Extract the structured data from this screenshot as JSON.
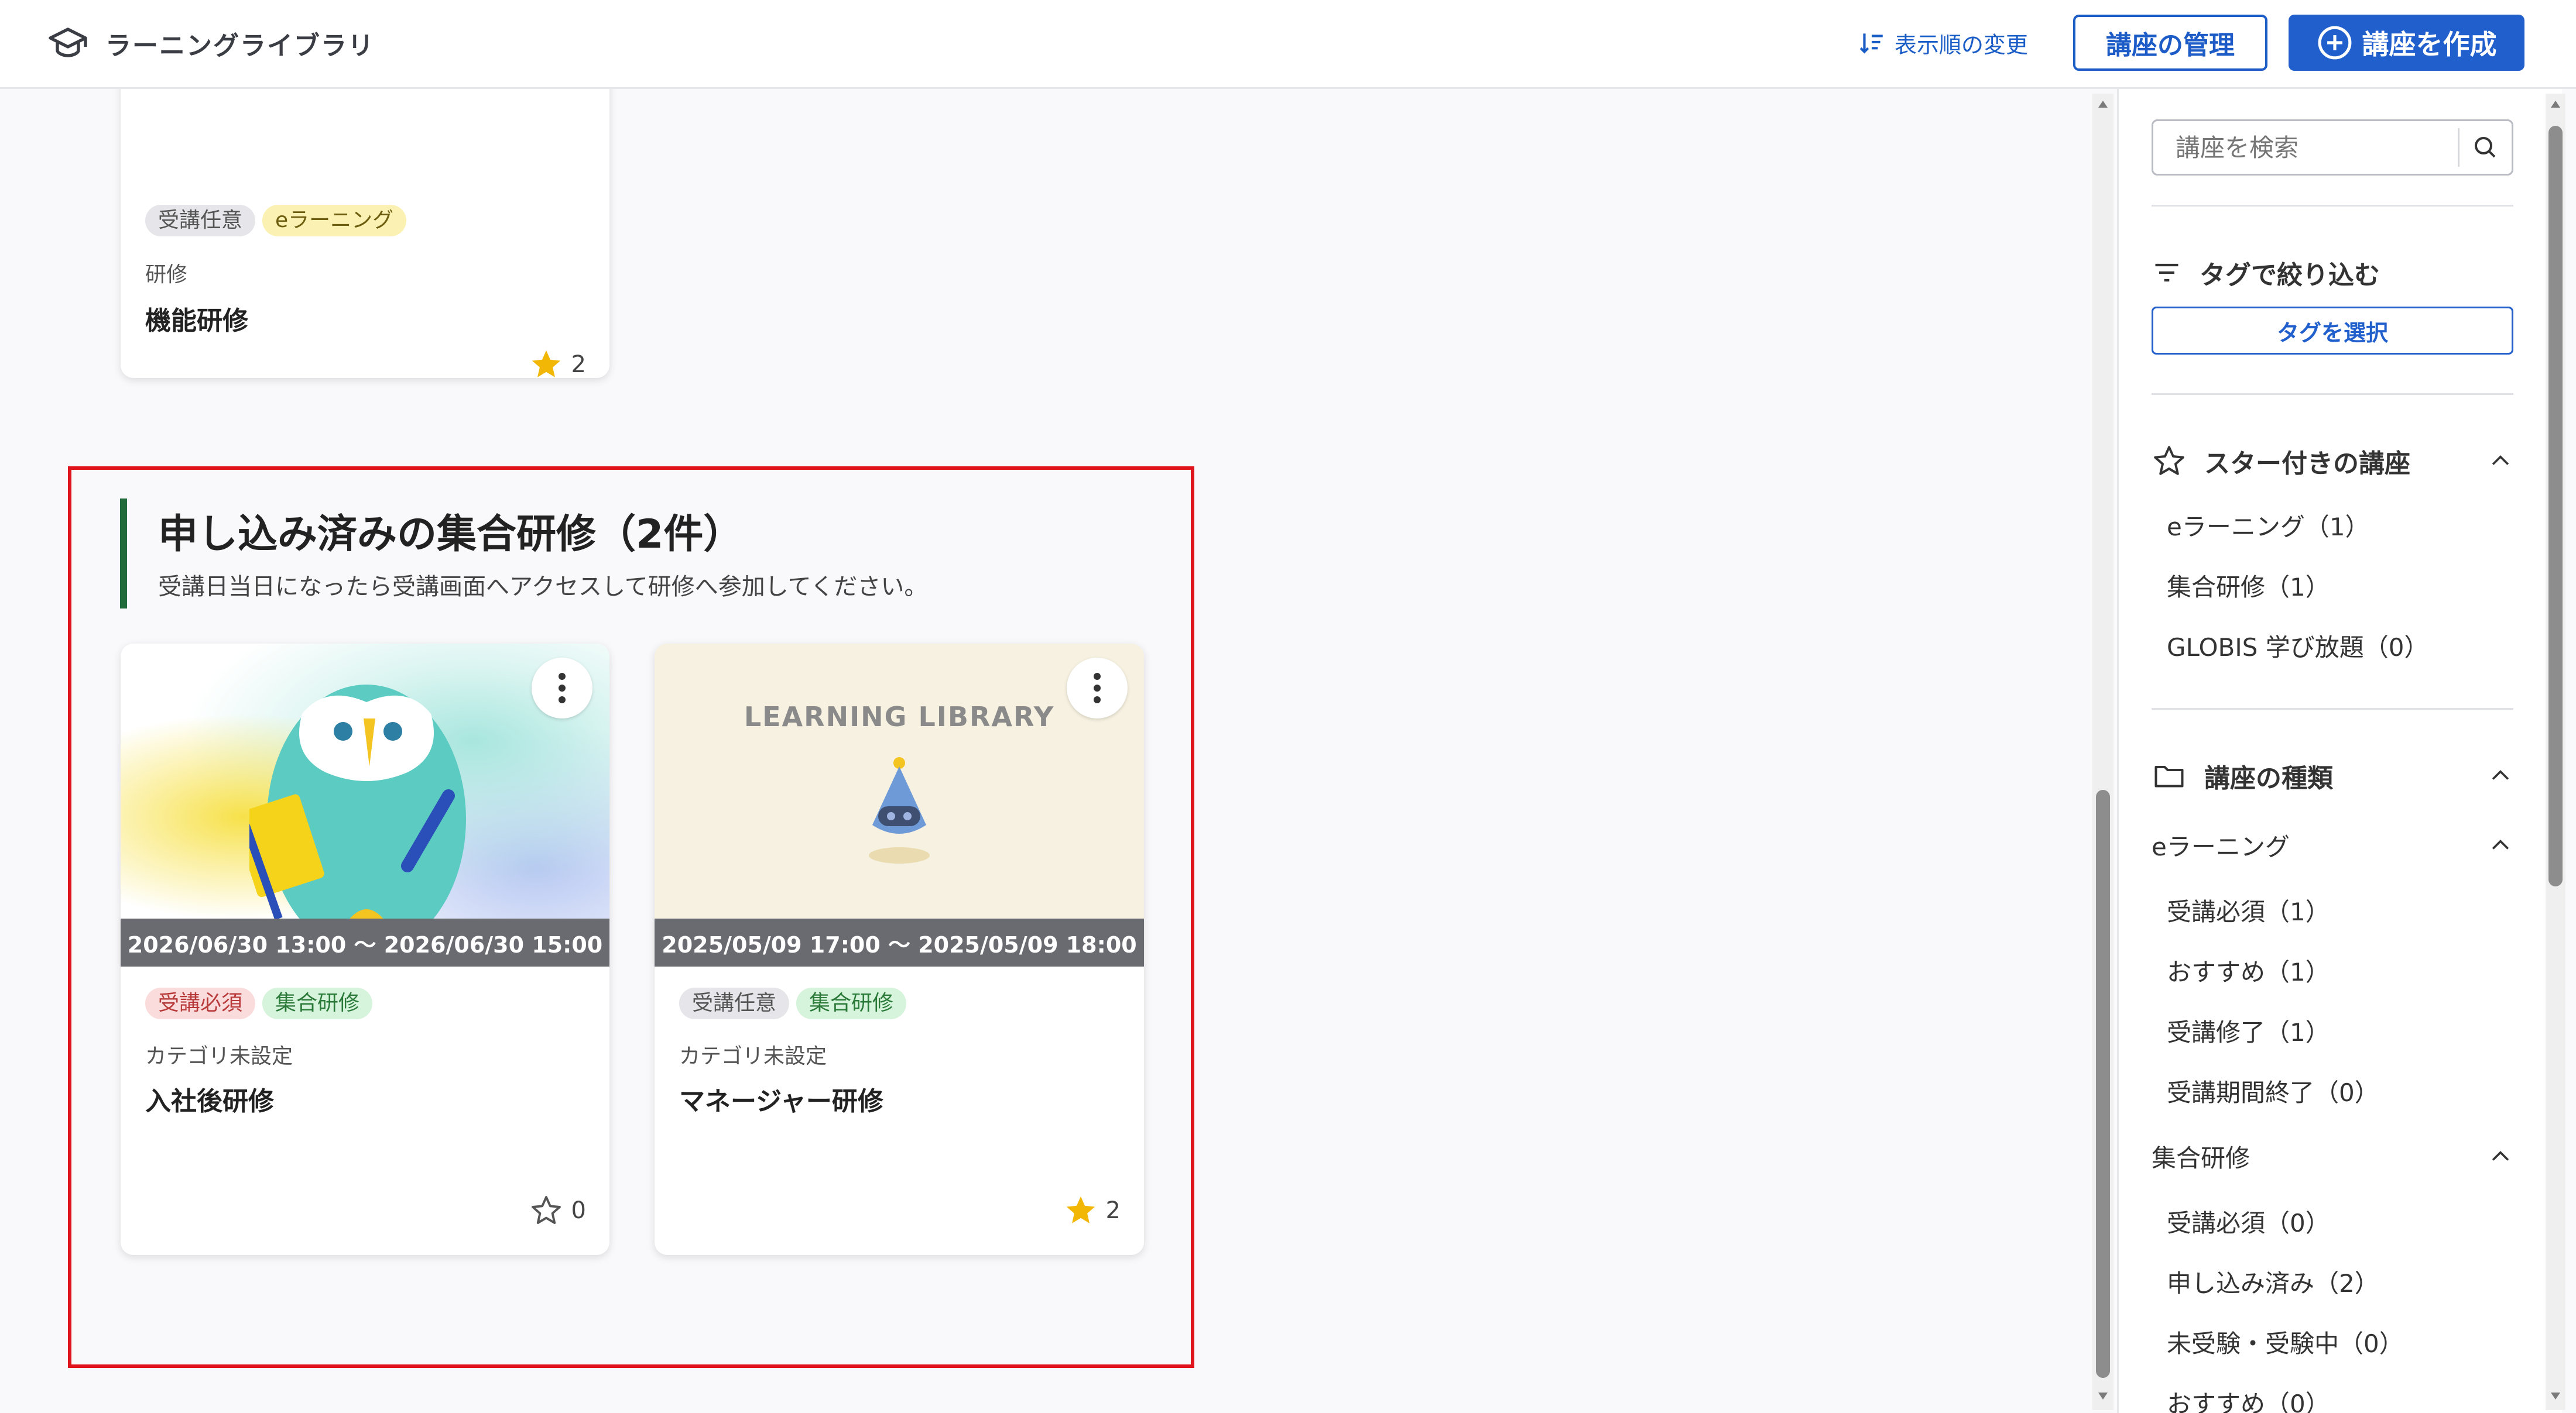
{
  "header": {
    "app_title": "ラーニングライブラリ",
    "sort_label": "表示順の変更",
    "manage_label": "講座の管理",
    "create_label": "講座を作成"
  },
  "top_card": {
    "tags": [
      "受講任意",
      "eラーニング"
    ],
    "category": "研修",
    "title": "機能研修",
    "stars": "2"
  },
  "section": {
    "title": "申し込み済みの集合研修（2件）",
    "subtitle": "受講日当日になったら受講画面へアクセスして研修へ参加してください。",
    "cards": [
      {
        "date": "2026/06/30 13:00 〜 2026/06/30 15:00",
        "tags": [
          "受講必須",
          "集合研修"
        ],
        "category": "カテゴリ未設定",
        "title": "入社後研修",
        "stars": "0"
      },
      {
        "thumb_text": "LEARNING LIBRARY",
        "date": "2025/05/09 17:00 〜 2025/05/09 18:00",
        "tags": [
          "受講任意",
          "集合研修"
        ],
        "category": "カテゴリ未設定",
        "title": "マネージャー研修",
        "stars": "2"
      }
    ]
  },
  "sidebar": {
    "search_placeholder": "講座を検索",
    "tag_filter_label": "タグで絞り込む",
    "tag_select_label": "タグを選択",
    "starred": {
      "title": "スター付きの講座",
      "items": [
        "eラーニング（1）",
        "集合研修（1）",
        "GLOBIS 学び放題（0）"
      ]
    },
    "types": {
      "title": "講座の種類",
      "elearning": {
        "title": "eラーニング",
        "items": [
          "受講必須（1）",
          "おすすめ（1）",
          "受講修了（1）",
          "受講期間終了（0）"
        ]
      },
      "group": {
        "title": "集合研修",
        "items": [
          "受講必須（0）",
          "申し込み済み（2）",
          "未受験・受験中（0）",
          "おすすめ（0）"
        ]
      }
    }
  },
  "colors": {
    "accent": "#2160cc",
    "section_bar": "#1f6b3a",
    "highlight_box": "#e0141c",
    "star": "#f2b705"
  }
}
